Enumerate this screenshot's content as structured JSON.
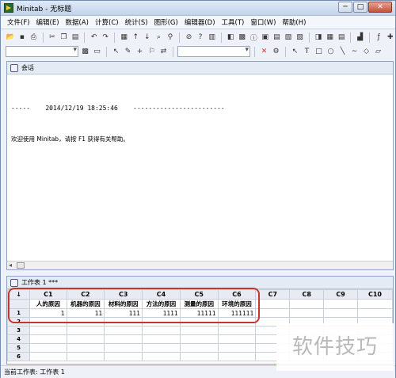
{
  "window": {
    "title": "Minitab - 无标题",
    "minimize": "─",
    "maximize": "□",
    "close": "✕"
  },
  "menu": [
    "文件(F)",
    "编辑(E)",
    "数据(A)",
    "计算(C)",
    "统计(S)",
    "图形(G)",
    "编辑器(D)",
    "工具(T)",
    "窗口(W)",
    "帮助(H)"
  ],
  "session": {
    "title": "会话",
    "timestamp_line": "-----    2014/12/19 18:25:46    ------------------------",
    "welcome": "欢迎使用 Minitab，请按 F1 获得有关帮助。"
  },
  "worksheet": {
    "title": "工作表 1 ***",
    "corner": "↓",
    "columns": [
      "C1",
      "C2",
      "C3",
      "C4",
      "C5",
      "C6",
      "C7",
      "C8",
      "C9",
      "C10"
    ],
    "names": [
      "人的原因",
      "机器的原因",
      "材料的原因",
      "方法的原因",
      "测量的原因",
      "环境的原因",
      "",
      "",
      "",
      ""
    ],
    "row_numbers": [
      "1",
      "2",
      "3",
      "4",
      "5",
      "6"
    ],
    "rows": [
      [
        "1",
        "11",
        "111",
        "1111",
        "11111",
        "111111",
        "",
        "",
        "",
        ""
      ],
      [
        "",
        "",
        "",
        "",
        "",
        "",
        "",
        "",
        "",
        ""
      ],
      [
        "",
        "",
        "",
        "",
        "",
        "",
        "",
        "",
        "",
        ""
      ],
      [
        "",
        "",
        "",
        "",
        "",
        "",
        "",
        "",
        "",
        ""
      ],
      [
        "",
        "",
        "",
        "",
        "",
        "",
        "",
        "",
        "",
        ""
      ],
      [
        "",
        "",
        "",
        "",
        "",
        "",
        "",
        "",
        "",
        ""
      ]
    ]
  },
  "status": "当前工作表: 工作表 1",
  "watermark": "软件技巧"
}
